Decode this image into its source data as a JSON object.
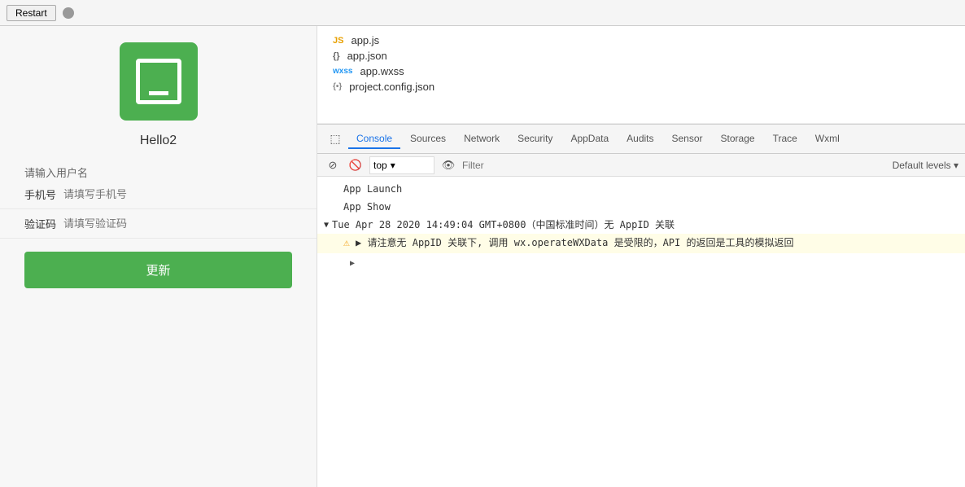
{
  "topbar": {
    "restart_label": "Restart"
  },
  "simulator": {
    "app_name": "Hello2",
    "user_placeholder": "请输入用户名",
    "phone_label": "手机号",
    "phone_placeholder": "请填写手机号",
    "code_label": "验证码",
    "code_placeholder": "请填写验证码",
    "update_label": "更新"
  },
  "file_tree": {
    "files": [
      {
        "name": "app.js",
        "icon": "JS",
        "type": "js"
      },
      {
        "name": "app.json",
        "icon": "{}",
        "type": "json"
      },
      {
        "name": "app.wxss",
        "icon": "wxss",
        "type": "wxss"
      },
      {
        "name": "project.config.json",
        "icon": "{•}",
        "type": "config"
      }
    ]
  },
  "devtools": {
    "tabs": [
      {
        "id": "console",
        "label": "Console",
        "active": true
      },
      {
        "id": "sources",
        "label": "Sources",
        "active": false
      },
      {
        "id": "network",
        "label": "Network",
        "active": false
      },
      {
        "id": "security",
        "label": "Security",
        "active": false
      },
      {
        "id": "appdata",
        "label": "AppData",
        "active": false
      },
      {
        "id": "audits",
        "label": "Audits",
        "active": false
      },
      {
        "id": "sensor",
        "label": "Sensor",
        "active": false
      },
      {
        "id": "storage",
        "label": "Storage",
        "active": false
      },
      {
        "id": "trace",
        "label": "Trace",
        "active": false
      },
      {
        "id": "wxml",
        "label": "Wxml",
        "active": false
      }
    ],
    "toolbar": {
      "top_value": "top",
      "filter_placeholder": "Filter",
      "default_levels": "Default levels ▾"
    },
    "console_lines": [
      {
        "type": "normal",
        "text": "App Launch"
      },
      {
        "type": "normal",
        "text": "App Show"
      },
      {
        "type": "section",
        "text": "Tue Apr 28 2020 14:49:04 GMT+0800（中国标准时间）无 AppID 关联"
      },
      {
        "type": "warning",
        "text": "▶ 请注意无 AppID 关联下, 调用 wx.operateWXData 是受限的，API 的返回是工具的模拟返回"
      }
    ]
  }
}
